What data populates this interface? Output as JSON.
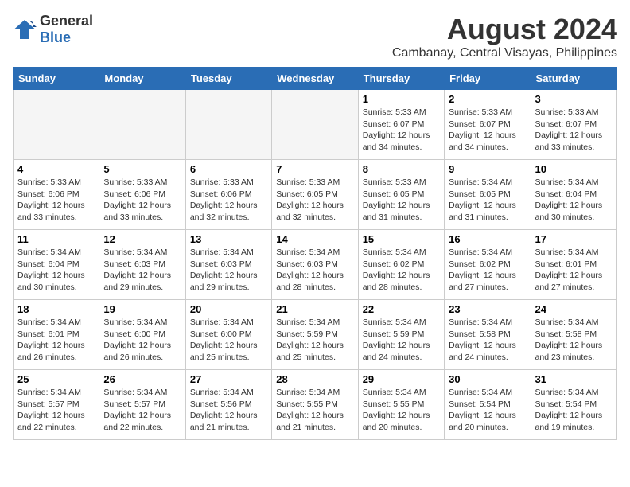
{
  "logo": {
    "general": "General",
    "blue": "Blue"
  },
  "title": "August 2024",
  "subtitle": "Cambanay, Central Visayas, Philippines",
  "headers": [
    "Sunday",
    "Monday",
    "Tuesday",
    "Wednesday",
    "Thursday",
    "Friday",
    "Saturday"
  ],
  "weeks": [
    [
      {
        "day": "",
        "info": ""
      },
      {
        "day": "",
        "info": ""
      },
      {
        "day": "",
        "info": ""
      },
      {
        "day": "",
        "info": ""
      },
      {
        "day": "1",
        "info": "Sunrise: 5:33 AM\nSunset: 6:07 PM\nDaylight: 12 hours\nand 34 minutes."
      },
      {
        "day": "2",
        "info": "Sunrise: 5:33 AM\nSunset: 6:07 PM\nDaylight: 12 hours\nand 34 minutes."
      },
      {
        "day": "3",
        "info": "Sunrise: 5:33 AM\nSunset: 6:07 PM\nDaylight: 12 hours\nand 33 minutes."
      }
    ],
    [
      {
        "day": "4",
        "info": "Sunrise: 5:33 AM\nSunset: 6:06 PM\nDaylight: 12 hours\nand 33 minutes."
      },
      {
        "day": "5",
        "info": "Sunrise: 5:33 AM\nSunset: 6:06 PM\nDaylight: 12 hours\nand 33 minutes."
      },
      {
        "day": "6",
        "info": "Sunrise: 5:33 AM\nSunset: 6:06 PM\nDaylight: 12 hours\nand 32 minutes."
      },
      {
        "day": "7",
        "info": "Sunrise: 5:33 AM\nSunset: 6:05 PM\nDaylight: 12 hours\nand 32 minutes."
      },
      {
        "day": "8",
        "info": "Sunrise: 5:33 AM\nSunset: 6:05 PM\nDaylight: 12 hours\nand 31 minutes."
      },
      {
        "day": "9",
        "info": "Sunrise: 5:34 AM\nSunset: 6:05 PM\nDaylight: 12 hours\nand 31 minutes."
      },
      {
        "day": "10",
        "info": "Sunrise: 5:34 AM\nSunset: 6:04 PM\nDaylight: 12 hours\nand 30 minutes."
      }
    ],
    [
      {
        "day": "11",
        "info": "Sunrise: 5:34 AM\nSunset: 6:04 PM\nDaylight: 12 hours\nand 30 minutes."
      },
      {
        "day": "12",
        "info": "Sunrise: 5:34 AM\nSunset: 6:03 PM\nDaylight: 12 hours\nand 29 minutes."
      },
      {
        "day": "13",
        "info": "Sunrise: 5:34 AM\nSunset: 6:03 PM\nDaylight: 12 hours\nand 29 minutes."
      },
      {
        "day": "14",
        "info": "Sunrise: 5:34 AM\nSunset: 6:03 PM\nDaylight: 12 hours\nand 28 minutes."
      },
      {
        "day": "15",
        "info": "Sunrise: 5:34 AM\nSunset: 6:02 PM\nDaylight: 12 hours\nand 28 minutes."
      },
      {
        "day": "16",
        "info": "Sunrise: 5:34 AM\nSunset: 6:02 PM\nDaylight: 12 hours\nand 27 minutes."
      },
      {
        "day": "17",
        "info": "Sunrise: 5:34 AM\nSunset: 6:01 PM\nDaylight: 12 hours\nand 27 minutes."
      }
    ],
    [
      {
        "day": "18",
        "info": "Sunrise: 5:34 AM\nSunset: 6:01 PM\nDaylight: 12 hours\nand 26 minutes."
      },
      {
        "day": "19",
        "info": "Sunrise: 5:34 AM\nSunset: 6:00 PM\nDaylight: 12 hours\nand 26 minutes."
      },
      {
        "day": "20",
        "info": "Sunrise: 5:34 AM\nSunset: 6:00 PM\nDaylight: 12 hours\nand 25 minutes."
      },
      {
        "day": "21",
        "info": "Sunrise: 5:34 AM\nSunset: 5:59 PM\nDaylight: 12 hours\nand 25 minutes."
      },
      {
        "day": "22",
        "info": "Sunrise: 5:34 AM\nSunset: 5:59 PM\nDaylight: 12 hours\nand 24 minutes."
      },
      {
        "day": "23",
        "info": "Sunrise: 5:34 AM\nSunset: 5:58 PM\nDaylight: 12 hours\nand 24 minutes."
      },
      {
        "day": "24",
        "info": "Sunrise: 5:34 AM\nSunset: 5:58 PM\nDaylight: 12 hours\nand 23 minutes."
      }
    ],
    [
      {
        "day": "25",
        "info": "Sunrise: 5:34 AM\nSunset: 5:57 PM\nDaylight: 12 hours\nand 22 minutes."
      },
      {
        "day": "26",
        "info": "Sunrise: 5:34 AM\nSunset: 5:57 PM\nDaylight: 12 hours\nand 22 minutes."
      },
      {
        "day": "27",
        "info": "Sunrise: 5:34 AM\nSunset: 5:56 PM\nDaylight: 12 hours\nand 21 minutes."
      },
      {
        "day": "28",
        "info": "Sunrise: 5:34 AM\nSunset: 5:55 PM\nDaylight: 12 hours\nand 21 minutes."
      },
      {
        "day": "29",
        "info": "Sunrise: 5:34 AM\nSunset: 5:55 PM\nDaylight: 12 hours\nand 20 minutes."
      },
      {
        "day": "30",
        "info": "Sunrise: 5:34 AM\nSunset: 5:54 PM\nDaylight: 12 hours\nand 20 minutes."
      },
      {
        "day": "31",
        "info": "Sunrise: 5:34 AM\nSunset: 5:54 PM\nDaylight: 12 hours\nand 19 minutes."
      }
    ]
  ]
}
